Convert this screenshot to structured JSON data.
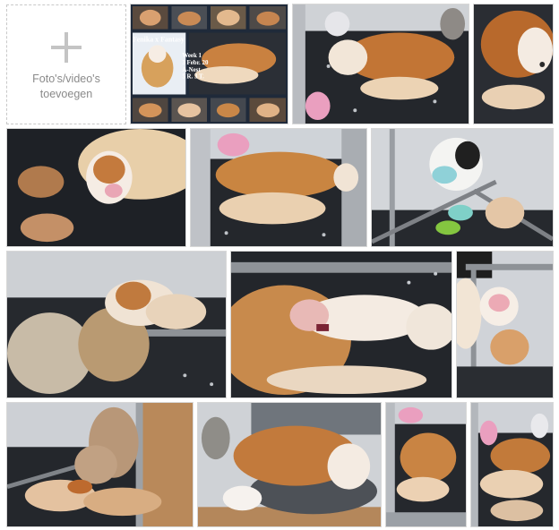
{
  "upload": {
    "label": "Foto's/video's toevoegen",
    "icon": "plus-icon"
  },
  "collage": {
    "litter_title": "Fenika x Fantasy",
    "lines": [
      "Week 1",
      "3 Febr. 20",
      "A-Nest",
      "5 R. 3 T."
    ]
  },
  "photos": [
    {
      "name": "photo-collage-week-1"
    },
    {
      "name": "photo-mother-nursing-puppies"
    },
    {
      "name": "photo-mother-face-closeup"
    },
    {
      "name": "photo-newborn-puppy-between-paws"
    },
    {
      "name": "photo-mother-with-litter-in-whelping-box"
    },
    {
      "name": "photo-plush-cow-toy-in-box"
    },
    {
      "name": "photo-puppies-sleeping-with-plush-toys"
    },
    {
      "name": "photo-puppy-sleeping-on-mother"
    },
    {
      "name": "photo-puppy-corner-with-toys"
    },
    {
      "name": "photo-puppies-pile-with-teddy-bears"
    },
    {
      "name": "photo-mother-resting-in-dog-bed"
    },
    {
      "name": "photo-litter-nursing-small"
    },
    {
      "name": "photo-litter-nursing-small-2"
    }
  ],
  "colors": {
    "fleece": "#23262b",
    "fur_red": "#c57a3a",
    "fur_cream": "#f1dcc4",
    "box_gray": "#c9ccd0",
    "plush_pink": "#e9a3bf"
  }
}
